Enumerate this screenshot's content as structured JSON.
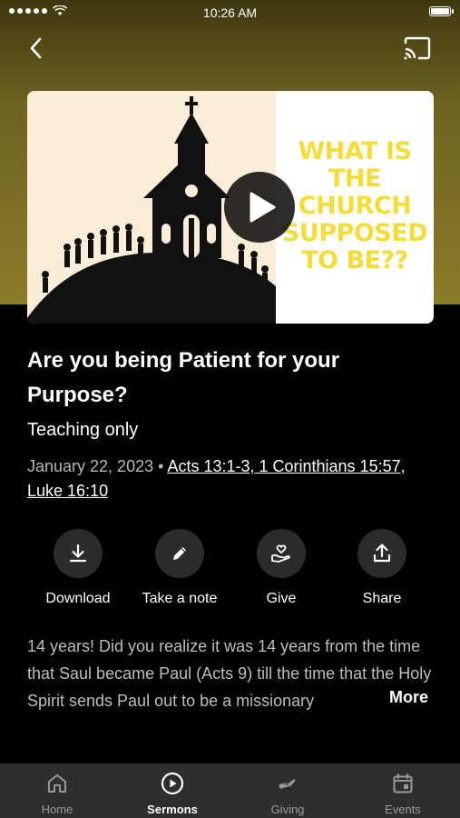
{
  "status_bar": {
    "time": "10:26 AM",
    "battery_level": 1.0
  },
  "artwork": {
    "text_lines": [
      "WHAT IS",
      "THE",
      "CHURCH",
      "SUPPOSED",
      "TO BE??"
    ],
    "colors": {
      "text": "#f2dd3a",
      "left_bg": "#fbeed9"
    }
  },
  "sermon": {
    "title": "Are you being Patient for your Purpose?",
    "subtitle": "Teaching only",
    "date": "January 22, 2023",
    "separator": "•",
    "scripture_refs": "Acts 13:1-3, 1 Corinthians 15:57, Luke 16:10",
    "description": "14 years! Did you realize it was 14 years from the time that Saul became Paul (Acts 9) till the time that the Holy Spirit sends Paul out to be a missionary",
    "more_label": "More"
  },
  "actions": [
    {
      "label": "Download",
      "icon": "download-icon"
    },
    {
      "label": "Take a note",
      "icon": "pencil-icon"
    },
    {
      "label": "Give",
      "icon": "give-hand-heart-icon"
    },
    {
      "label": "Share",
      "icon": "share-icon"
    }
  ],
  "tabs": [
    {
      "label": "Home",
      "icon": "home-icon",
      "active": false
    },
    {
      "label": "Sermons",
      "icon": "play-circle-icon",
      "active": true
    },
    {
      "label": "Giving",
      "icon": "giving-hand-icon",
      "active": false
    },
    {
      "label": "Events",
      "icon": "calendar-icon",
      "active": false
    }
  ],
  "colors": {
    "background": "#000000",
    "tab_bar": "#2e2e2e",
    "hero_tint": "#8b7c2a"
  }
}
